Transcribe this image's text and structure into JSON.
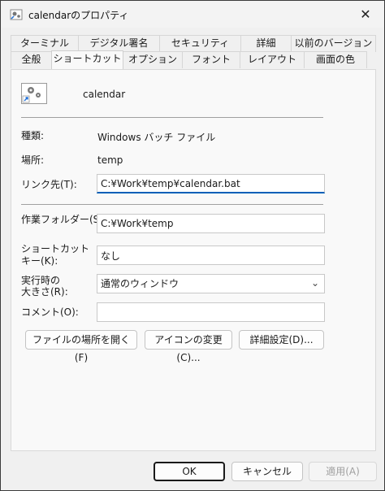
{
  "window": {
    "title": "calendarのプロパティ",
    "close_glyph": "✕"
  },
  "tabs": {
    "row1": [
      "ターミナル",
      "デジタル署名",
      "セキュリティ",
      "詳細",
      "以前のバージョン"
    ],
    "row2": [
      "全般",
      "ショートカット",
      "オプション",
      "フォント",
      "レイアウト",
      "画面の色"
    ],
    "active": "ショートカット"
  },
  "shortcut": {
    "name": "calendar",
    "type_label": "種類:",
    "type_value": "Windows バッチ ファイル",
    "location_label": "場所:",
    "location_value": "temp",
    "target_label": "リンク先(T):",
    "target_value": "C:¥Work¥temp¥calendar.bat",
    "startin_label": "作業フォルダー(S):",
    "startin_value": "C:¥Work¥temp",
    "hotkey_label_1": "ショートカット",
    "hotkey_label_2": "キー(K):",
    "hotkey_value": "なし",
    "run_label_1": "実行時の",
    "run_label_2": "大きさ(R):",
    "run_value": "通常のウィンドウ",
    "comment_label": "コメント(O):",
    "comment_value": ""
  },
  "buttons": {
    "open_location": "ファイルの場所を開く(F)",
    "change_icon": "アイコンの変更(C)...",
    "advanced": "詳細設定(D)...",
    "ok": "OK",
    "cancel": "キャンセル",
    "apply": "適用(A)"
  },
  "icons": {
    "app": "gear-shortcut-icon",
    "arrow": "chevron-down-icon"
  },
  "colors": {
    "accent": "#005fb8"
  }
}
